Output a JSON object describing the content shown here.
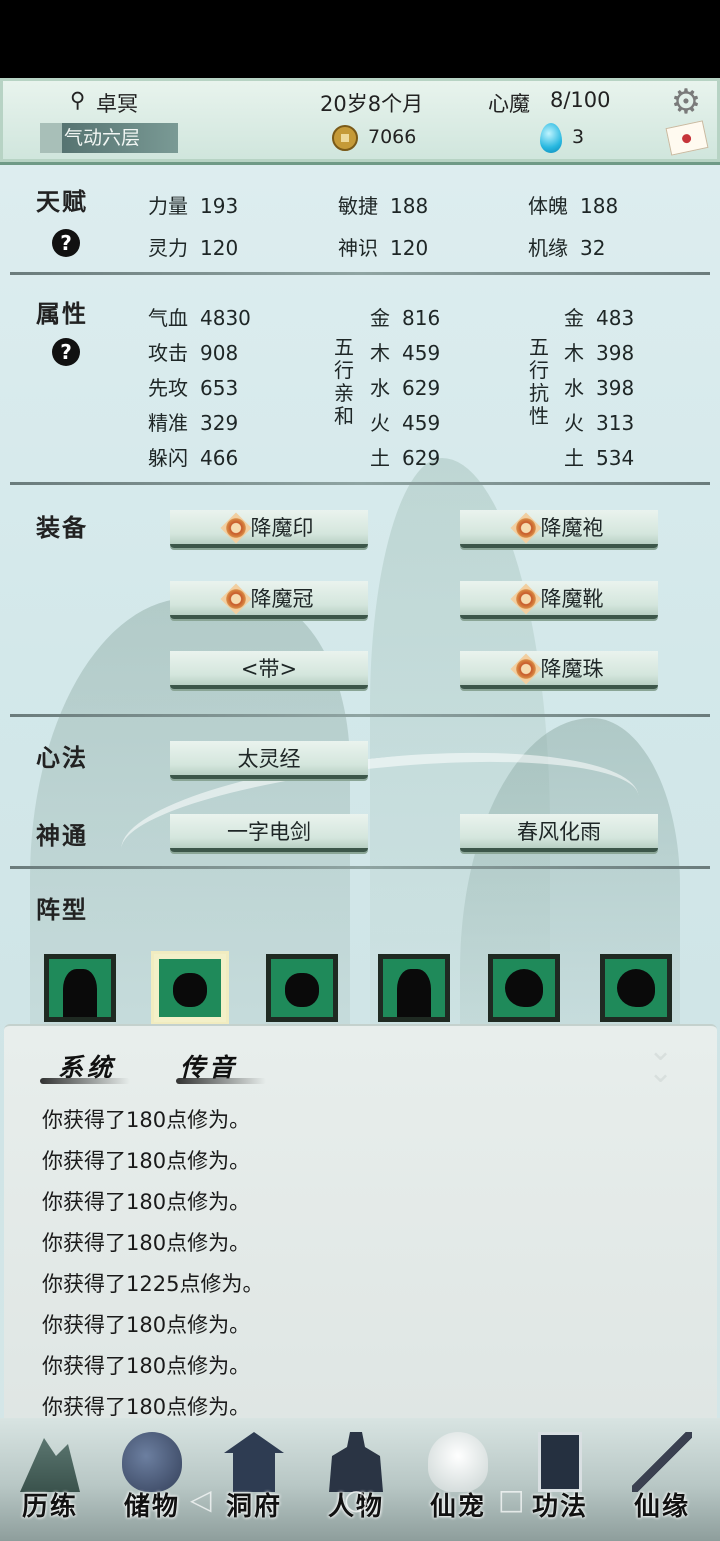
{
  "header": {
    "name": "卓冥",
    "age": "20岁8个月",
    "inner_demon_label": "心魔",
    "inner_demon_value": "8/100",
    "realm": "气动六层",
    "coins": "7066",
    "gems": "3"
  },
  "talent": {
    "title": "天赋",
    "stats": [
      {
        "label": "力量",
        "value": "193"
      },
      {
        "label": "敏捷",
        "value": "188"
      },
      {
        "label": "体魄",
        "value": "188"
      },
      {
        "label": "灵力",
        "value": "120"
      },
      {
        "label": "神识",
        "value": "120"
      },
      {
        "label": "机缘",
        "value": "32"
      }
    ]
  },
  "attributes": {
    "title": "属性",
    "base": [
      {
        "label": "气血",
        "value": "4830"
      },
      {
        "label": "攻击",
        "value": "908"
      },
      {
        "label": "先攻",
        "value": "653"
      },
      {
        "label": "精准",
        "value": "329"
      },
      {
        "label": "躲闪",
        "value": "466"
      }
    ],
    "affinity_label": [
      "五",
      "行",
      "亲",
      "和"
    ],
    "affinity": [
      {
        "label": "金",
        "value": "816"
      },
      {
        "label": "木",
        "value": "459"
      },
      {
        "label": "水",
        "value": "629"
      },
      {
        "label": "火",
        "value": "459"
      },
      {
        "label": "土",
        "value": "629"
      }
    ],
    "resist_label": [
      "五",
      "行",
      "抗",
      "性"
    ],
    "resist": [
      {
        "label": "金",
        "value": "483"
      },
      {
        "label": "木",
        "value": "398"
      },
      {
        "label": "水",
        "value": "398"
      },
      {
        "label": "火",
        "value": "313"
      },
      {
        "label": "土",
        "value": "534"
      }
    ]
  },
  "equipment": {
    "title": "装备",
    "slots": [
      "降魔印",
      "降魔袍",
      "降魔冠",
      "降魔靴",
      "<带>",
      "降魔珠"
    ]
  },
  "method": {
    "title": "心法",
    "value": "太灵经"
  },
  "skills": {
    "title": "神通",
    "items": [
      "一字电剑",
      "春风化雨"
    ]
  },
  "formation": {
    "title": "阵型"
  },
  "messages": {
    "tabs": [
      "系统",
      "传音"
    ],
    "lines": [
      "你获得了180点修为。",
      "你获得了180点修为。",
      "你获得了180点修为。",
      "你获得了180点修为。",
      "你获得了1225点修为。",
      "你获得了180点修为。",
      "你获得了180点修为。",
      "你获得了180点修为。"
    ]
  },
  "nav": [
    "历练",
    "储物",
    "洞府",
    "人物",
    "仙宠",
    "功法",
    "仙缘"
  ]
}
